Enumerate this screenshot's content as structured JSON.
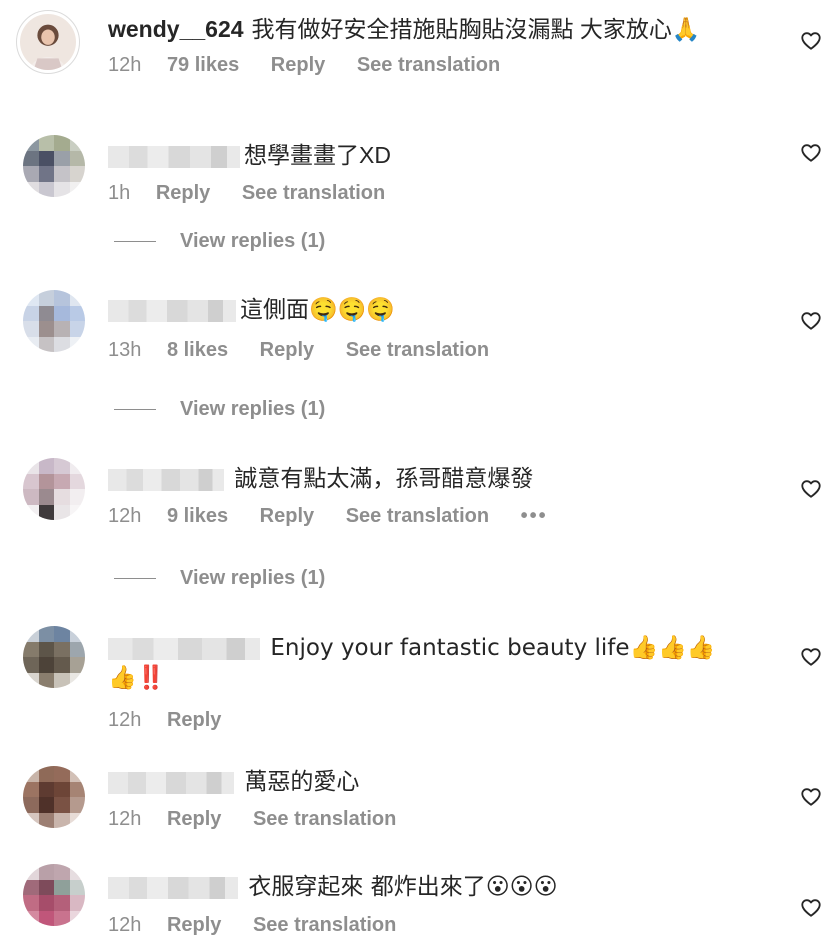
{
  "comments": [
    {
      "username": "wendy__624",
      "text": "我有做好安全措施貼胸貼沒漏點 大家放心🙏",
      "time": "12h",
      "likes": "79 likes",
      "reply": "Reply",
      "translate": "See translation"
    },
    {
      "username": "",
      "text": "想學畫畫了XD",
      "time": "1h",
      "reply": "Reply",
      "translate": "See translation",
      "view_replies": "View replies (1)"
    },
    {
      "username": "",
      "text": "這側面🤤🤤🤤",
      "time": "13h",
      "likes": "8 likes",
      "reply": "Reply",
      "translate": "See translation",
      "view_replies": "View replies (1)"
    },
    {
      "username": "",
      "text": "誠意有點太滿，孫哥醋意爆發",
      "time": "12h",
      "likes": "9 likes",
      "reply": "Reply",
      "translate": "See translation",
      "more": "•••",
      "view_replies": "View replies (1)"
    },
    {
      "username": "",
      "text_line1": "Enjoy your fantastic beauty life👍👍👍",
      "text_line2": "👍‼️",
      "time": "12h",
      "reply": "Reply"
    },
    {
      "username": "",
      "text": "萬惡的愛心",
      "time": "12h",
      "reply": "Reply",
      "translate": "See translation"
    },
    {
      "username": "",
      "text": "衣服穿起來 都炸出來了😮😮😮",
      "time": "12h",
      "reply": "Reply",
      "translate": "See translation"
    }
  ],
  "icons": {
    "like": "heart-outline-icon",
    "more": "more-horizontal-icon"
  },
  "colors": {
    "text": "#262626",
    "secondary": "#8e8e8e",
    "divider": "#8e8e8e"
  }
}
